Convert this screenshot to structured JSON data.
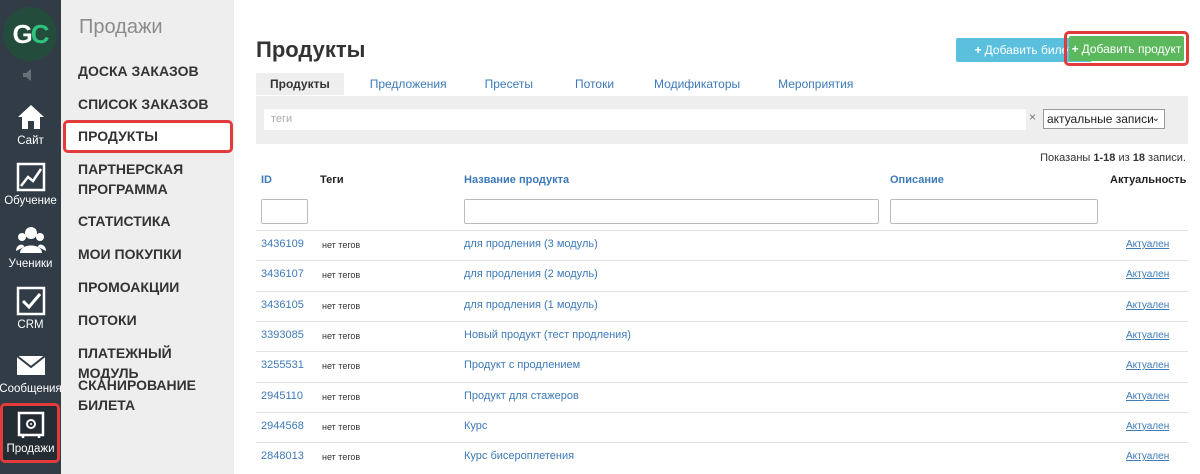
{
  "rail": {
    "logo": "GC",
    "items": [
      {
        "label": "Сайт",
        "icon": "home-icon"
      },
      {
        "label": "Обучение",
        "icon": "chart-icon"
      },
      {
        "label": "Ученики",
        "icon": "users-icon"
      },
      {
        "label": "CRM",
        "icon": "checkbox-icon"
      },
      {
        "label": "Сообщения",
        "icon": "mail-icon"
      },
      {
        "label": "Продажи",
        "icon": "safe-icon"
      }
    ]
  },
  "submenu": {
    "title": "Продажи",
    "items": [
      "ДОСКА ЗАКАЗОВ",
      "СПИСОК ЗАКАЗОВ",
      "ПРОДУКТЫ",
      "ПАРТНЕРСКАЯ ПРОГРАММА",
      "СТАТИСТИКА",
      "МОИ ПОКУПКИ",
      "ПРОМОАКЦИИ",
      "ПОТОКИ",
      "ПЛАТЕЖНЫЙ МОДУЛЬ",
      "СКАНИРОВАНИЕ БИЛЕТА"
    ]
  },
  "page": {
    "title": "Продукты",
    "add_ticket": "Добавить билет",
    "add_product": "Добавить продукт"
  },
  "tabs": [
    "Продукты",
    "Предложения",
    "Пресеты",
    "Потоки",
    "Модификаторы",
    "Мероприятия"
  ],
  "filter": {
    "tags_placeholder": "теги",
    "clear": "×",
    "select_value": "актуальные записи"
  },
  "records": {
    "prefix": "Показаны ",
    "range": "1-18",
    "middle": " из ",
    "total": "18",
    "suffix": " записи."
  },
  "table": {
    "headers": {
      "id": "ID",
      "tags": "Теги",
      "name": "Название продукта",
      "desc": "Описание",
      "status": "Актуальность"
    },
    "rows": [
      {
        "id": "3436109",
        "tags": "нет тегов",
        "name": "для продления (3 модуль)",
        "status": "Актуален"
      },
      {
        "id": "3436107",
        "tags": "нет тегов",
        "name": "для продления (2 модуль)",
        "status": "Актуален"
      },
      {
        "id": "3436105",
        "tags": "нет тегов",
        "name": "для продления (1 модуль)",
        "status": "Актуален"
      },
      {
        "id": "3393085",
        "tags": "нет тегов",
        "name": "Новый продукт (тест продления)",
        "status": "Актуален"
      },
      {
        "id": "3255531",
        "tags": "нет тегов",
        "name": "Продукт с продлением",
        "status": "Актуален"
      },
      {
        "id": "2945110",
        "tags": "нет тегов",
        "name": "Продукт для стажеров",
        "status": "Актуален"
      },
      {
        "id": "2944568",
        "tags": "нет тегов",
        "name": "Курс",
        "status": "Актуален"
      },
      {
        "id": "2848013",
        "tags": "нет тегов",
        "name": "Курс бисероплетения",
        "status": "Актуален"
      }
    ]
  }
}
